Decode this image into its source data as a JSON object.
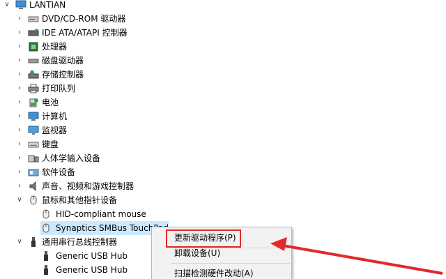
{
  "computer_name": "LANTIAN",
  "tree": {
    "items": [
      {
        "label": "DVD/CD-ROM 驱动器",
        "icon": "dvd-drive-icon"
      },
      {
        "label": "IDE ATA/ATAPI 控制器",
        "icon": "ide-controller-icon"
      },
      {
        "label": "处理器",
        "icon": "processor-icon"
      },
      {
        "label": "磁盘驱动器",
        "icon": "disk-drive-icon"
      },
      {
        "label": "存储控制器",
        "icon": "storage-controller-icon"
      },
      {
        "label": "打印队列",
        "icon": "printer-icon"
      },
      {
        "label": "电池",
        "icon": "battery-icon"
      },
      {
        "label": "计算机",
        "icon": "computer-icon"
      },
      {
        "label": "监视器",
        "icon": "monitor-icon"
      },
      {
        "label": "键盘",
        "icon": "keyboard-icon"
      },
      {
        "label": "人体学输入设备",
        "icon": "hid-icon"
      },
      {
        "label": "软件设备",
        "icon": "software-device-icon"
      },
      {
        "label": "声音、视频和游戏控制器",
        "icon": "speaker-icon"
      },
      {
        "label": "鼠标和其他指针设备",
        "icon": "mouse-icon"
      }
    ],
    "mouse_children": [
      {
        "label": "HID-compliant mouse",
        "icon": "mouse-icon"
      },
      {
        "label": "Synaptics SMBus TouchPad",
        "icon": "mouse-icon"
      }
    ],
    "usb": {
      "label": "通用串行总线控制器",
      "icon": "usb-icon"
    },
    "usb_children": [
      {
        "label": "Generic USB Hub",
        "icon": "usb-hub-icon"
      },
      {
        "label": "Generic USB Hub",
        "icon": "usb-hub-icon"
      }
    ]
  },
  "context_menu": {
    "items": [
      {
        "label": "更新驱动程序(P)"
      },
      {
        "label": "卸载设备(U)"
      },
      {
        "label": "扫描检测硬件改动(A)"
      }
    ]
  },
  "colors": {
    "selection": "#cce8ff",
    "highlight_border": "#e02a2a",
    "arrow": "#e02a2a"
  }
}
